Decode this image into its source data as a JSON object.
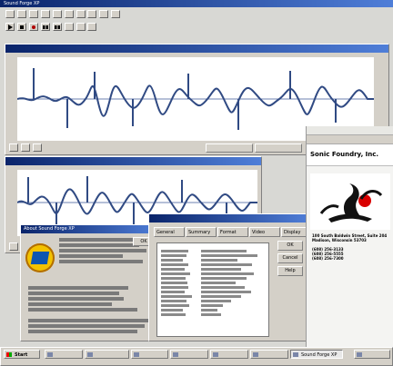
{
  "app": {
    "title": "Sound Forge XP",
    "icons": [
      "play-icon",
      "stop-icon",
      "record-icon",
      "rewind-icon",
      "fast-forward-icon"
    ]
  },
  "top_window": {
    "time_start": "",
    "time_end": ""
  },
  "second_window": {
    "time_start": "",
    "time_end": ""
  },
  "about_dialog": {
    "title": "About Sound Forge XP",
    "ok": "OK"
  },
  "properties_dialog": {
    "title": "",
    "tabs": [
      "General",
      "Summary",
      "Format",
      "Video",
      "Display"
    ],
    "ok": "OK",
    "cancel": "Cancel",
    "help": "Help"
  },
  "sonic_panel": {
    "tabs": [
      "",
      "",
      ""
    ],
    "brand": "Sonic Foundry, Inc.",
    "address": "100 South Baldwin Street, Suite 204",
    "city": "Madison, Wisconsin 53703",
    "phone_1": "(608) 256-3133",
    "phone_2": "(608) 256-5555",
    "fax": "(608) 256-7300",
    "web": "",
    "email": "",
    "support": "",
    "copyright": "",
    "links": [
      "",
      "",
      "",
      "",
      "",
      ""
    ]
  },
  "taskbar": {
    "start": "Start",
    "items": [
      "",
      "",
      "",
      "",
      "",
      "",
      "Sound Forge XP"
    ],
    "time": ""
  },
  "colors": {
    "title_blue": "#0a246a",
    "wave_blue": "#304a83",
    "panel_gray": "#d4d0c8",
    "background": "#d8d8d4"
  }
}
